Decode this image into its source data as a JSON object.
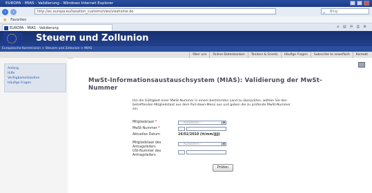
{
  "browser": {
    "title": "EUROPA - MIAS - Validierung - Windows Internet Explorer",
    "url": "http://ec.europa.eu/taxation_customs/vies/vieshome.do",
    "search_placeholder": "Bing",
    "favorites_label": "Favoriten",
    "tab_title": "EUROPA - MIAS - Validierung"
  },
  "site": {
    "banner_title": "Steuern und Zollunion",
    "breadcrumb": "Europäische Kommission > Steuern und Zollunion > MIAS"
  },
  "topnav": [
    "Über uns",
    "Online-Datenbanken",
    "Tenders & Grants",
    "Häufige Fragen",
    "Subscribe to newsflash",
    "Kontakt"
  ],
  "sidebar": {
    "items": [
      "Anfang",
      "Hilfe",
      "Verfügbarkeitszeiten",
      "Häufige Fragen"
    ]
  },
  "content": {
    "title": "MwSt-Informationsaustauschsystem (MIAS): Validierung der MwSt-Nummer",
    "intro": "Um die Gültigkeit einer MwSt-Nummer in einem bestimmten Land zu überprüfen, wählen Sie den betreffenden Mitgliedstaat aus dem Pull-down-Menü aus und geben die zu prüfende MwSt-Nummer ein.",
    "form": {
      "member_state_label": "Mitgliedstaat",
      "member_state_value": "-- Auswählen --",
      "vat_number_label": "MwSt-Nummer",
      "vat_prefix": "--",
      "date_label": "Aktuelles Datum",
      "date_value": "26/02/2010 (tt/mm/jjjj)",
      "requester_state_label": "Mitgliedstaat des Antragstellers",
      "requester_state_value": "-- Auswählen --",
      "requester_vat_label": "USt-Nummer des Antragstellers",
      "requester_prefix": "--",
      "required_marker": "*",
      "submit_label": "Prüfen"
    }
  },
  "colors": {
    "banner": "#1b3a86",
    "breadcrumb_bar": "#2c4f9e",
    "sidebar_bg": "#dde4ee",
    "sidebar_link": "#2d56a8",
    "title_text": "#4a4a5a"
  }
}
